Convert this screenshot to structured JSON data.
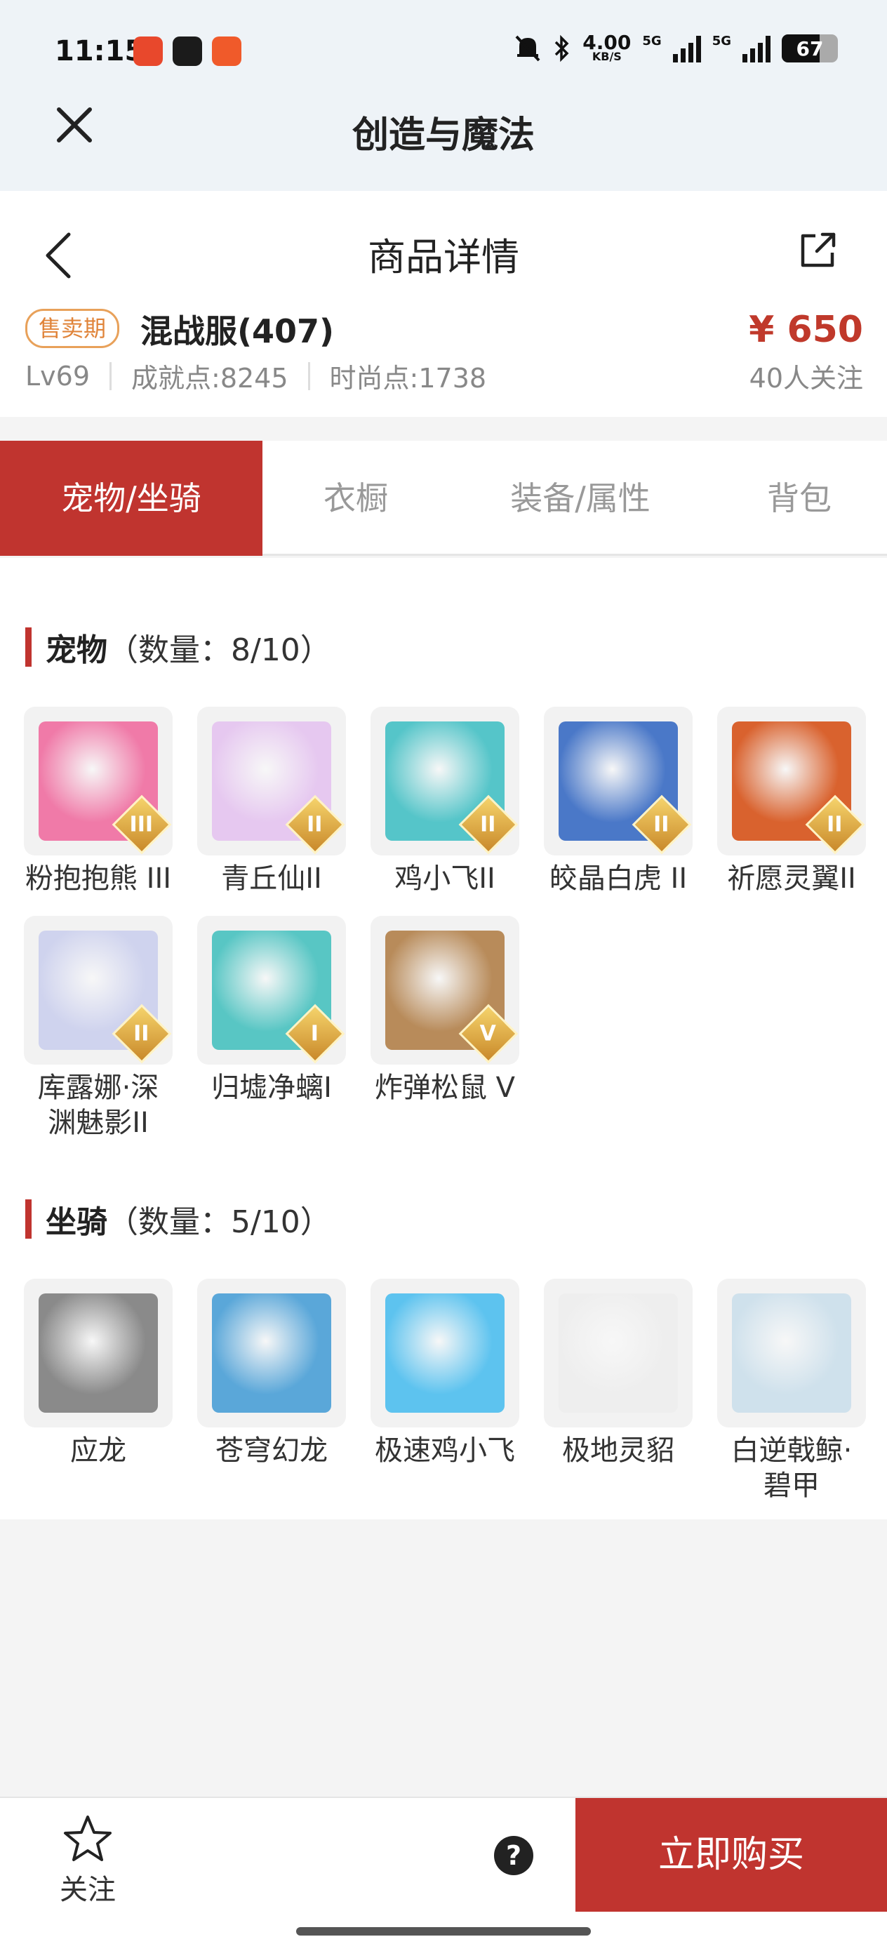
{
  "status_bar": {
    "time": "11:15",
    "net_speed": "4.00",
    "net_unit": "KB/S",
    "sig1": "5G",
    "sig2": "5G",
    "battery": "67",
    "battery_level": 0.67,
    "app_icon_colors": [
      "#e8482c",
      "#1b1b1b",
      "#f05a2a"
    ]
  },
  "app": {
    "title": "创造与魔法"
  },
  "detail": {
    "page_title": "商品详情",
    "tag": "售卖期",
    "server": "混战服(407)",
    "price": "¥ 650",
    "level": "Lv69",
    "achievement": "成就点:8245",
    "fashion": "时尚点:1738",
    "followers": "40人关注"
  },
  "tabs": [
    {
      "label": "宠物/坐骑",
      "active": true
    },
    {
      "label": "衣橱",
      "active": false
    },
    {
      "label": "装备/属性",
      "active": false
    },
    {
      "label": "背包",
      "active": false
    }
  ],
  "pets": {
    "title": "宠物",
    "count": "（数量：8/10）",
    "items": [
      {
        "name": "粉抱抱熊 III",
        "grade": "III",
        "color": "#f07aa8",
        "icon": "pink-bear"
      },
      {
        "name": "青丘仙II",
        "grade": "II",
        "color": "#e6c8f0",
        "icon": "fox-fairy"
      },
      {
        "name": "鸡小飞II",
        "grade": "II",
        "color": "#55c5c9",
        "icon": "chick"
      },
      {
        "name": "皎晶白虎 II",
        "grade": "II",
        "color": "#4a78c8",
        "icon": "white-tiger"
      },
      {
        "name": "祈愿灵翼II",
        "grade": "II",
        "color": "#d9622e",
        "icon": "griffin"
      },
      {
        "name": "库露娜·深渊魅影II",
        "grade": "II",
        "color": "#cfd3ee",
        "icon": "abyss-girl"
      },
      {
        "name": "归墟净螭I",
        "grade": "I",
        "color": "#58c6c4",
        "icon": "dragon"
      },
      {
        "name": "炸弹松鼠 V",
        "grade": "V",
        "color": "#b88b5a",
        "icon": "squirrel"
      }
    ]
  },
  "mounts": {
    "title": "坐骑",
    "count": "（数量：5/10）",
    "items": [
      {
        "name": "应龙",
        "color": "#8a8a8a",
        "icon": "ying-dragon"
      },
      {
        "name": "苍穹幻龙",
        "color": "#5aa7d9",
        "icon": "sky-dragon"
      },
      {
        "name": "极速鸡小飞",
        "color": "#5dc3ef",
        "icon": "blue-chick"
      },
      {
        "name": "极地灵貂",
        "color": "#eeeeee",
        "icon": "polar-marten"
      },
      {
        "name": "白逆戟鲸·碧甲",
        "color": "#cfe1ec",
        "icon": "orca"
      }
    ]
  },
  "bottom_bar": {
    "follow_label": "关注",
    "help": "?",
    "buy_label": "立即购买"
  }
}
